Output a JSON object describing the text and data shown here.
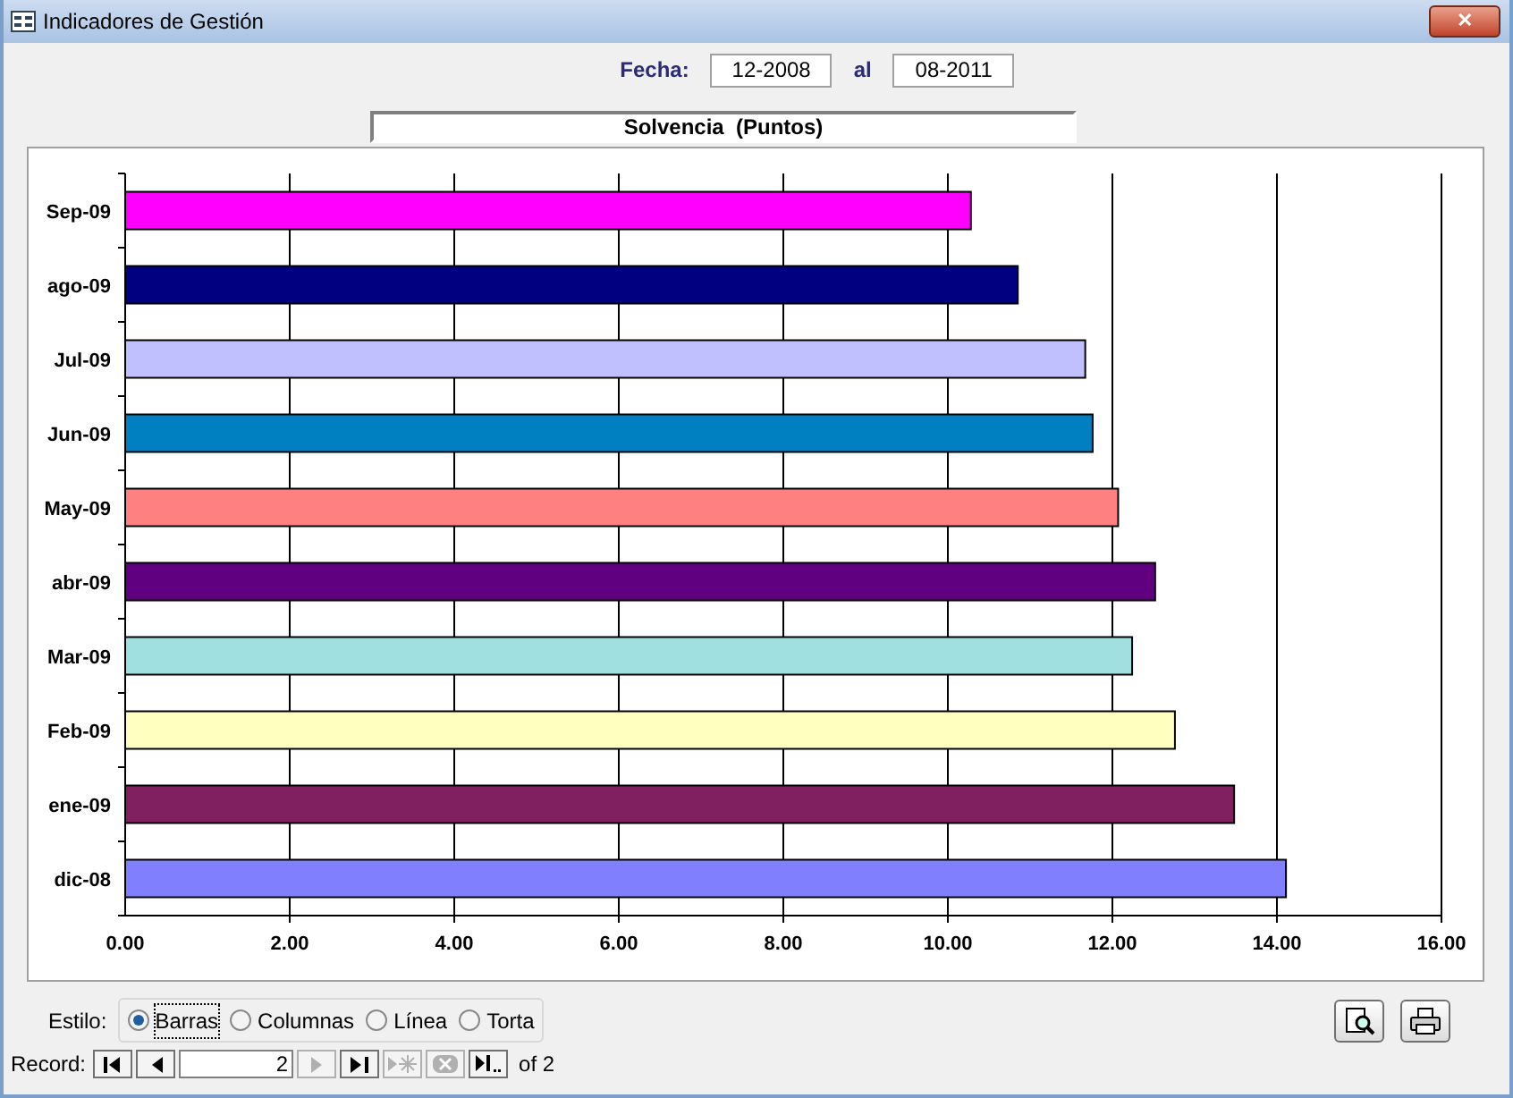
{
  "window": {
    "title": "Indicadores de Gestión",
    "close": "✕"
  },
  "filter": {
    "label": "Fecha:",
    "from": "12-2008",
    "to_label": "al",
    "to": "08-2011"
  },
  "chart_title": "Solvencia  (Puntos)",
  "chart_data": {
    "type": "bar",
    "orientation": "horizontal",
    "categories": [
      "Sep-09",
      "ago-09",
      "Jul-09",
      "Jun-09",
      "May-09",
      "abr-09",
      "Mar-09",
      "Feb-09",
      "ene-09",
      "dic-08"
    ],
    "grid": true,
    "series": [
      {
        "values": [
          10.28,
          10.85,
          11.67,
          11.76,
          12.07,
          12.52,
          12.24,
          12.76,
          13.48,
          14.11
        ]
      }
    ],
    "colors": [
      "#ff00ff",
      "#000080",
      "#c0c0ff",
      "#0080c0",
      "#ff8080",
      "#600080",
      "#a0e0e0",
      "#ffffc0",
      "#802060",
      "#8080ff"
    ],
    "xlim": [
      0,
      16
    ],
    "xticks": [
      {
        "value": 0,
        "label": "0.00"
      },
      {
        "value": 2,
        "label": "2.00"
      },
      {
        "value": 4,
        "label": "4.00"
      },
      {
        "value": 6,
        "label": "6.00"
      },
      {
        "value": 8,
        "label": "8.00"
      },
      {
        "value": 10,
        "label": "10.00"
      },
      {
        "value": 12,
        "label": "12.00"
      },
      {
        "value": 14,
        "label": "14.00"
      },
      {
        "value": 16,
        "label": "16.00"
      }
    ]
  },
  "style": {
    "label": "Estilo:",
    "options": [
      {
        "label": "Barras",
        "selected": true
      },
      {
        "label": "Columnas",
        "selected": false
      },
      {
        "label": "Línea",
        "selected": false
      },
      {
        "label": "Torta",
        "selected": false
      }
    ]
  },
  "navigation": {
    "label": "Record:",
    "current": "2",
    "total": "of 2"
  }
}
